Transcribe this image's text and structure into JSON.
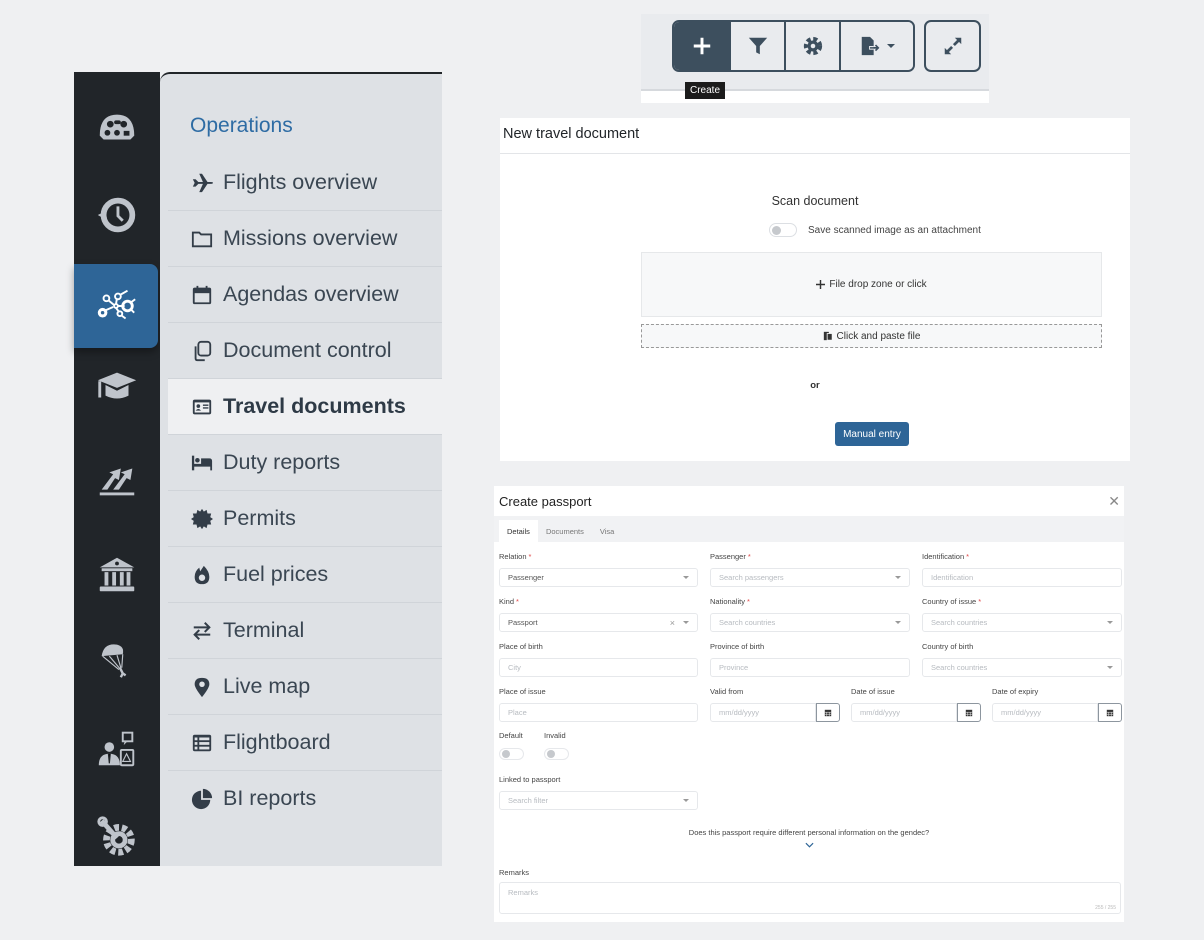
{
  "toolbar": {
    "buttons": [
      {
        "icon": "plus-icon",
        "label": "Create"
      },
      {
        "icon": "filter-icon",
        "label": "Filter"
      },
      {
        "icon": "gear-icon",
        "label": "Settings"
      },
      {
        "icon": "export-icon",
        "label": "Export"
      }
    ],
    "expand_icon": "expand-icon",
    "tooltip": "Create"
  },
  "rail": {
    "items": [
      {
        "icon": "cockpit-icon"
      },
      {
        "icon": "history-clock-icon"
      },
      {
        "icon": "network-nodes-icon",
        "active": true
      },
      {
        "icon": "graduation-cap-icon"
      },
      {
        "icon": "trending-up-icon"
      },
      {
        "icon": "bank-icon"
      },
      {
        "icon": "parachute-icon"
      },
      {
        "icon": "person-clipboard-icon"
      },
      {
        "icon": "wrench-gear-icon"
      }
    ]
  },
  "menu": {
    "title": "Operations",
    "items": [
      {
        "label": "Flights overview",
        "icon": "plane-icon"
      },
      {
        "label": "Missions overview",
        "icon": "folder-icon"
      },
      {
        "label": "Agendas overview",
        "icon": "calendar-icon"
      },
      {
        "label": "Document control",
        "icon": "copy-icon"
      },
      {
        "label": "Travel documents",
        "icon": "id-card-icon",
        "active": true
      },
      {
        "label": "Duty reports",
        "icon": "bed-icon"
      },
      {
        "label": "Permits",
        "icon": "certificate-icon"
      },
      {
        "label": "Fuel prices",
        "icon": "fire-icon"
      },
      {
        "label": "Terminal",
        "icon": "exchange-icon"
      },
      {
        "label": "Live map",
        "icon": "map-pin-icon"
      },
      {
        "label": "Flightboard",
        "icon": "list-table-icon"
      },
      {
        "label": "BI reports",
        "icon": "pie-chart-icon"
      }
    ]
  },
  "new_travel_document": {
    "title": "New travel document",
    "scan_title": "Scan document",
    "save_scanned_label": "Save scanned image as an attachment",
    "save_scanned_on": false,
    "dropzone_label": "File drop zone or click",
    "paste_label": "Click and paste file",
    "or_label": "or",
    "manual_entry_label": "Manual entry"
  },
  "create_passport": {
    "title": "Create passport",
    "tabs": [
      "Details",
      "Documents",
      "Visa"
    ],
    "active_tab": "Details",
    "fields": {
      "relation": {
        "label": "Relation",
        "required": true,
        "value": "Passenger"
      },
      "passenger": {
        "label": "Passenger",
        "required": true,
        "placeholder": "Search passengers"
      },
      "identification": {
        "label": "Identification",
        "required": true,
        "placeholder": "Identification"
      },
      "kind": {
        "label": "Kind",
        "required": true,
        "value": "Passport"
      },
      "nationality": {
        "label": "Nationality",
        "required": true,
        "placeholder": "Search countries"
      },
      "country_of_issue": {
        "label": "Country of issue",
        "required": true,
        "placeholder": "Search countries"
      },
      "place_of_birth": {
        "label": "Place of birth",
        "placeholder": "City"
      },
      "province_of_birth": {
        "label": "Province of birth",
        "placeholder": "Province"
      },
      "country_of_birth": {
        "label": "Country of birth",
        "placeholder": "Search countries"
      },
      "place_of_issue": {
        "label": "Place of issue",
        "placeholder": "Place"
      },
      "valid_from": {
        "label": "Valid from",
        "placeholder": "mm/dd/yyyy"
      },
      "date_of_issue": {
        "label": "Date of issue",
        "placeholder": "mm/dd/yyyy"
      },
      "date_of_expiry": {
        "label": "Date of expiry",
        "placeholder": "mm/dd/yyyy"
      },
      "default": {
        "label": "Default",
        "on": false
      },
      "invalid": {
        "label": "Invalid",
        "on": false
      },
      "linked_to_passport": {
        "label": "Linked to passport",
        "placeholder": "Search filter"
      }
    },
    "gendec_question": "Does this passport require different personal information on the gendec?",
    "remarks": {
      "label": "Remarks",
      "placeholder": "Remarks",
      "counter": "255 / 255"
    },
    "required_mark": "*",
    "clear_mark": "×"
  },
  "colors": {
    "accent": "#2e6597",
    "rail_bg": "#212529",
    "menu_bg": "#dee1e5",
    "menu_title": "#2e6ca4",
    "toolbar_dark": "#3d4f5e",
    "required": "#e04848"
  }
}
